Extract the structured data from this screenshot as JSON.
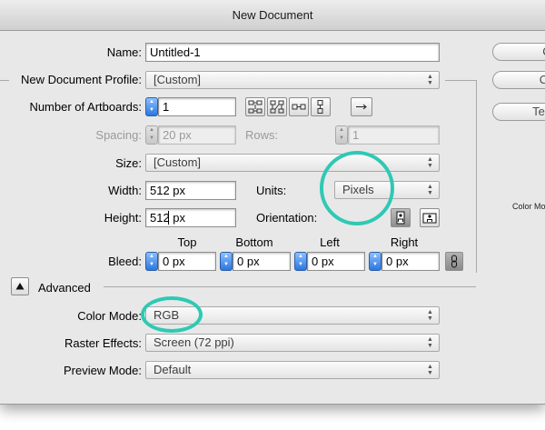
{
  "window": {
    "title": "New Document"
  },
  "form": {
    "name_label": "Name:",
    "name_value": "Untitled-1",
    "profile_label": "New Document Profile:",
    "profile_value": "[Custom]",
    "artboards_label": "Number of Artboards:",
    "artboards_value": "1",
    "spacing_label": "Spacing:",
    "spacing_value": "20 px",
    "rows_label": "Rows:",
    "rows_value": "1",
    "size_label": "Size:",
    "size_value": "[Custom]",
    "width_label": "Width:",
    "width_value": "512 px",
    "units_label": "Units:",
    "units_value": "Pixels",
    "height_label": "Height:",
    "height_value": "512 px",
    "orientation_label": "Orientation:",
    "bleed_label": "Bleed:",
    "bleed": {
      "top_label": "Top",
      "top_value": "0 px",
      "bottom_label": "Bottom",
      "bottom_value": "0 px",
      "left_label": "Left",
      "left_value": "0 px",
      "right_label": "Right",
      "right_value": "0 px"
    },
    "advanced_label": "Advanced",
    "color_mode_label": "Color Mode:",
    "color_mode_value": "RGB",
    "raster_label": "Raster Effects:",
    "raster_value": "Screen (72 ppi)",
    "preview_label": "Preview Mode:",
    "preview_value": "Default"
  },
  "side": {
    "ok_label": "C",
    "cancel_label": "Ca",
    "templates_label": "Temp",
    "color_mode_info": "Color Mo"
  },
  "icons": {
    "artboard_grid": "grid-by-row-icon",
    "artboard_col": "grid-by-column-icon",
    "artboard_row": "arrange-by-row-icon",
    "artboard_column": "arrange-by-column-icon",
    "direction": "right-arrow-icon",
    "portrait": "portrait-orientation-icon",
    "landscape": "landscape-orientation-icon",
    "link": "link-icon",
    "disclosure": "triangle-up-icon"
  },
  "colors": {
    "highlight": "#2ec9b4",
    "stepper_blue": "#2a77e0"
  }
}
